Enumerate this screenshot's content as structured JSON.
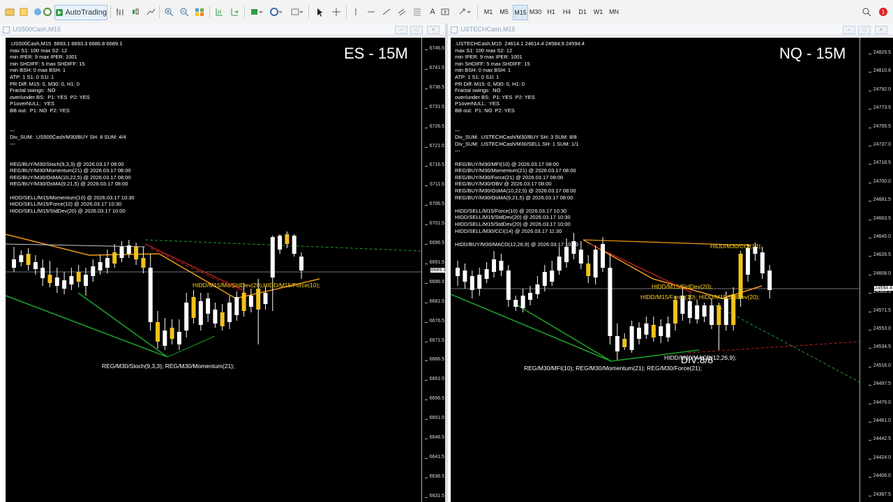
{
  "toolbar": {
    "autotrading": "AutoTrading",
    "timeframes": [
      "M1",
      "M5",
      "M15",
      "M30",
      "H1",
      "H4",
      "D1",
      "W1",
      "MN"
    ],
    "active_tf": "M15",
    "tools_letter": "A"
  },
  "left": {
    "title": ".US500Cash,M15",
    "label": "ES - 15M",
    "info": [
      ".US500Cash,M15  6693.1 6693.3 6686.8 6689.1",
      "max S1: 100 max S2: 12",
      "min IPER: 9 max IPER: 1001",
      "min SHDIFF: 5 max SHDIFF: 15",
      "min BSH: 0 max BSH: 1",
      "ATP: 1 S1: 0 S1l: 1",
      "PR Diff: M15: 0, M30: 0, H1: 0",
      "Fractal swings:  NO",
      "over/under BS:  P1: YES  P2: YES",
      "P1overNULL:  YES",
      "BB out:  P1: NO  P2: YES",
      "",
      "",
      "---",
      "Div_SUM: .US500Cash/M30/BUY SH: 8 SUM: 4/4",
      "---",
      "",
      "",
      "REG/BUY/M30/Stoch(9,3,3) @ 2026.03.17 08:00",
      "REG/BUY/M30/Momentum(21) @ 2026.03.17 08:00",
      "REG/BUY/M30/OsMA(10,22,5) @ 2026.03.17 08:00",
      "REG/BUY/M30/OsMA(9,21,5) @ 2026.03.17 08:00",
      "",
      "HIDD/SELL/M15/Momentum(10) @ 2026.03.17 10:30",
      "HIDD/SELL/M15/Force(10) @ 2026.03.17 10:30",
      "HIDD/SELL/M15/StdDev(20) @ 2026.03.17 10:00"
    ],
    "axis": [
      "6746.5",
      "6741.5",
      "6736.5",
      "6731.5",
      "6726.5",
      "6721.5",
      "6716.5",
      "6711.5",
      "6706.5",
      "6701.5",
      "6696.5",
      "6691.5",
      "6686.5",
      "6681.5",
      "6676.5",
      "6671.5",
      "6666.5",
      "6661.5",
      "6656.5",
      "6651.5",
      "6646.5",
      "6641.5",
      "6636.5",
      "6631.5"
    ],
    "price": "6689.1",
    "ann_hidd": "HIDD/M15/Mo/StdDev(20);HIDD/M15/Force(10);",
    "ann_reg": "REG/M30/Stoch(9,3,3); REG/M30/Momentum(21);"
  },
  "right": {
    "title": ".USTECHCash,M15",
    "label": "NQ - 15M",
    "info": [
      ".USTECHCash,M15  24614.1 24614.4 24584.9 24594.4",
      "max S1: 100 max S2: 12",
      "min IPER: 9 max IPER: 1001",
      "min SHDIFF: 5 max SHDIFF: 15",
      "min BSH: 0 max BSH: 1",
      "ATP: 1 S1: 0 S1l: 1",
      "PR Diff: M15: 0, M30: 0, H1: 0",
      "Fractal swings:  NO",
      "over/under BS:  P1: YES  P2: YES",
      "P1overNULL:  YES",
      "BB out:  P1: NO  P2: YES",
      "",
      "",
      "---",
      "Div_SUM: .USTECHCash/M30/BUY SH: 3 SUM: 8/8",
      "Div_SUM: .USTECHCash/M30/SELL SH: 1 SUM: 1/1",
      "---",
      "",
      "REG/BUY/M30/MFI(10) @ 2026.03.17 08:00",
      "REG/BUY/M30/Momentum(21) @ 2026.03.17 08:00",
      "REG/BUY/M30/Force(21) @ 2026.03.17 08:00",
      "REG/BUY/M30/OBV @ 2026.03.17 08:00",
      "REG/BUY/M30/OsMA(10,22,5) @ 2026.03.17 08:00",
      "REG/BUY/M30/OsMA(9,21,5) @ 2026.03.17 08:00",
      "",
      "HIDD/SELL/M15/Force(10) @ 2026.03.17 10:30",
      "HIDD/SELL/M15/StdDev(20) @ 2026.03.17 10:30",
      "HIDD/SELL/M15/StdDev(20) @ 2026.03.17 10:00",
      "HIDD/SELL/M30/CCI(14) @ 2026.03.17 11:30",
      "",
      "HIDD/BUY/M30/MACD(12,26,9) @ 2026.03.17 10:00"
    ],
    "axis": [
      "24829.5",
      "24810.6",
      "24792.0",
      "24773.5",
      "24755.5",
      "24737.0",
      "24718.5",
      "24700.0",
      "24681.5",
      "24663.5",
      "24645.0",
      "24626.5",
      "24608.0",
      "24589.5",
      "24571.5",
      "24553.0",
      "24534.5",
      "24516.0",
      "24497.5",
      "24479.0",
      "24461.0",
      "24442.5",
      "24424.0",
      "24406.0",
      "24387.5"
    ],
    "price": "24594.4",
    "ann_cci": "HIDD/M30/CCI(14);",
    "ann_std": "HIDD/M15/StdDev(20);",
    "ann_force": "HIDD/M15/Force(10); HIDD/M15/StdDev(20);",
    "ann_macd": "HIDD/M30/MACD(12,26,9);",
    "ann_reg": "REG/M30/MFI(10); REG/M30/Momentum(21); REG/M30/Force(21);",
    "div": "DIV:8/8"
  }
}
